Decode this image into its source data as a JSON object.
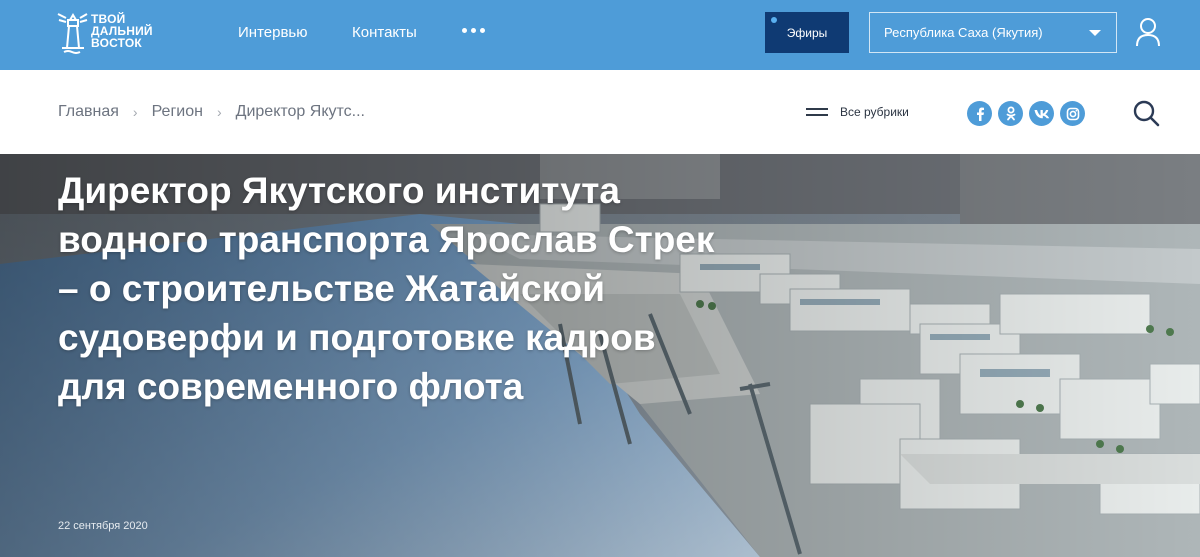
{
  "header": {
    "logo": {
      "line1": "твой",
      "line2": "дальний",
      "line3": "восток"
    },
    "nav": [
      {
        "label": "Интервью"
      },
      {
        "label": "Контакты"
      }
    ],
    "more_icon": "ellipsis-icon",
    "broadcast_label": "Эфиры",
    "region": {
      "selected": "Республика Саха (Якутия)"
    },
    "user_icon": "user-icon"
  },
  "subheader": {
    "breadcrumb": [
      "Главная",
      "Регион",
      "Директор Якутс..."
    ],
    "rubrics_label": "Все рубрики",
    "social": [
      "facebook-icon",
      "odnoklassniki-icon",
      "vk-icon",
      "instagram-icon"
    ],
    "search_icon": "search-icon"
  },
  "article": {
    "title": "Директор Якутского института водного транспорта Ярослав Стрек – о строительстве Жатайской судоверфи и подготовке кадров для современного флота",
    "date": "22 сентября 2020"
  },
  "colors": {
    "header_bg": "#4e9cd8",
    "broadcast_bg": "#0f3a73",
    "social_bg": "#4e9cd8",
    "text_dark": "#2b3442"
  }
}
